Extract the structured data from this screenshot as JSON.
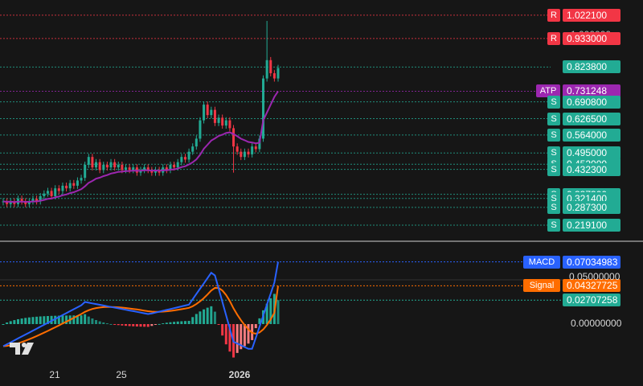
{
  "chart_data": [
    {
      "type": "candlestick",
      "title": "",
      "x_ticks": [
        "21",
        "25",
        "2026"
      ],
      "y_range": [
        0.17,
        1.08
      ],
      "resistance_levels": [
        {
          "tag": "R",
          "value": "1.022100",
          "color": "#f23645"
        },
        {
          "tag": "R",
          "value": "0.933000",
          "color": "#f23645"
        }
      ],
      "last_price": {
        "value": "0.823800",
        "color": "#22ab94"
      },
      "atp": {
        "tag": "ATP",
        "value": "0.731248",
        "color": "#9c27b0"
      },
      "support_levels": [
        {
          "tag": "S",
          "value": "0.690800"
        },
        {
          "tag": "S",
          "value": "0.626500"
        },
        {
          "tag": "S",
          "value": "0.564000"
        },
        {
          "tag": "S",
          "value": "0.495000"
        },
        {
          "tag": "S",
          "value": "0.452000"
        },
        {
          "tag": "S",
          "value": "0.432300"
        },
        {
          "tag": "S",
          "value": "0.337300"
        },
        {
          "tag": "S",
          "value": "0.321400"
        },
        {
          "tag": "S",
          "value": "0.287300"
        },
        {
          "tag": "S",
          "value": "0.219100"
        }
      ],
      "support_color": "#22ab94",
      "hidden_top_label": "1.000000",
      "series_close": [
        0.31,
        0.3,
        0.31,
        0.3,
        0.32,
        0.31,
        0.3,
        0.31,
        0.32,
        0.31,
        0.33,
        0.34,
        0.35,
        0.33,
        0.36,
        0.35,
        0.37,
        0.36,
        0.38,
        0.37,
        0.39,
        0.4,
        0.45,
        0.48,
        0.44,
        0.46,
        0.43,
        0.45,
        0.44,
        0.46,
        0.44,
        0.45,
        0.43,
        0.44,
        0.43,
        0.44,
        0.42,
        0.43,
        0.44,
        0.43,
        0.42,
        0.43,
        0.42,
        0.44,
        0.43,
        0.45,
        0.44,
        0.46,
        0.48,
        0.47,
        0.5,
        0.52,
        0.55,
        0.62,
        0.68,
        0.64,
        0.66,
        0.61,
        0.63,
        0.6,
        0.62,
        0.59,
        0.52,
        0.5,
        0.48,
        0.5,
        0.49,
        0.52,
        0.51,
        0.55,
        0.78,
        0.85,
        0.8,
        0.78,
        0.82
      ]
    },
    {
      "type": "line",
      "title": "MACD",
      "series": [
        {
          "name": "MACD",
          "value": "0.07034983",
          "color": "#2962ff"
        },
        {
          "name": "Signal",
          "value": "0.04327725",
          "color": "#ff6d00"
        }
      ],
      "histogram_last": {
        "value": "0.02707258",
        "color": "#22ab94"
      },
      "y_ticks": [
        "0.05000000",
        "0.00000000"
      ]
    }
  ],
  "logo": "TV"
}
